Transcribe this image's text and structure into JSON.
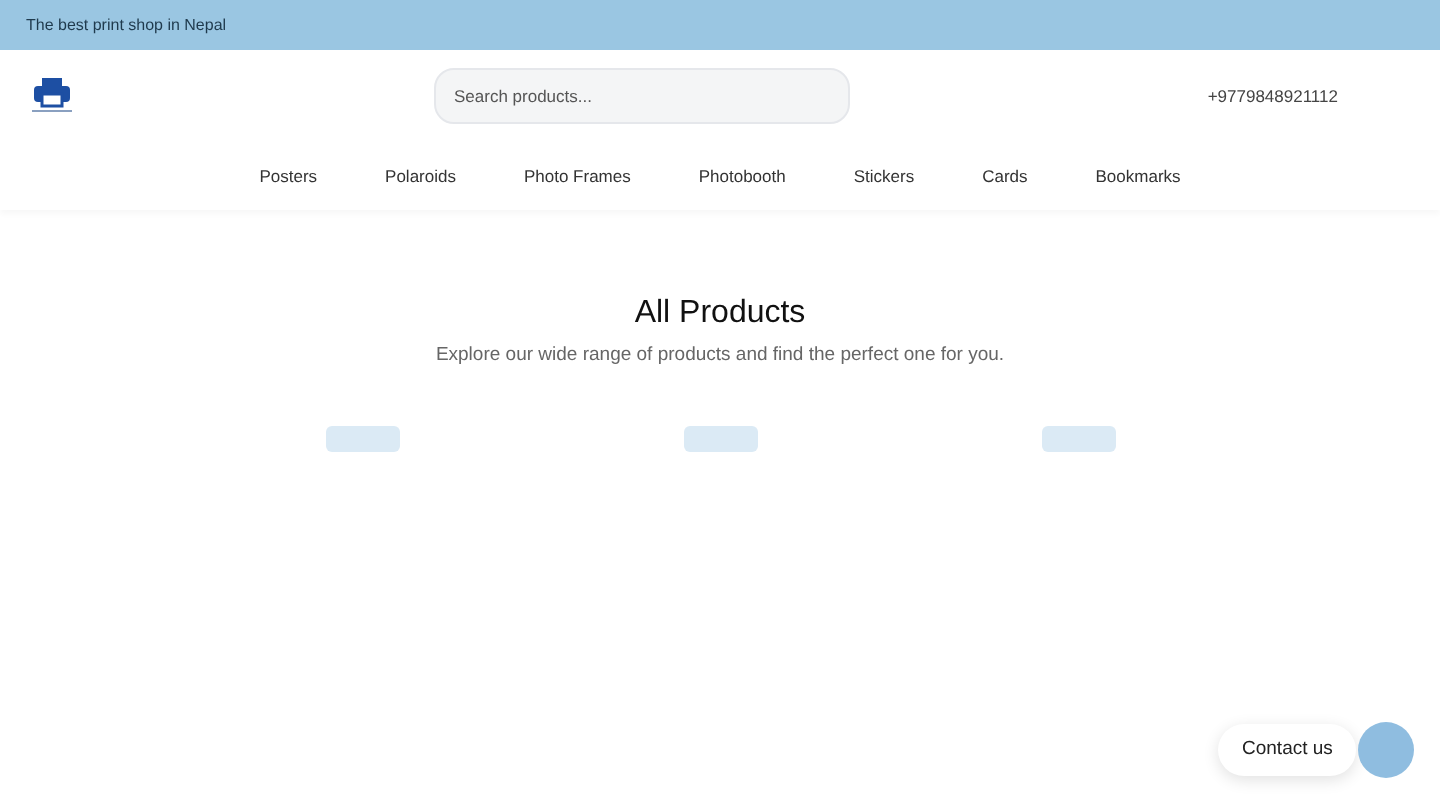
{
  "announcement": "The best print shop in Nepal",
  "search": {
    "placeholder": "Search products..."
  },
  "phone": "+9779848921112",
  "nav": [
    "Posters",
    "Polaroids",
    "Photo Frames",
    "Photobooth",
    "Stickers",
    "Cards",
    "Bookmarks"
  ],
  "heading": "All Products",
  "subheading": "Explore our wide range of products and find the perfect one for you.",
  "products": [
    {
      "kind": "placeholder"
    },
    {
      "kind": "placeholder"
    },
    {
      "kind": "placeholder"
    }
  ],
  "contact": "Contact us"
}
